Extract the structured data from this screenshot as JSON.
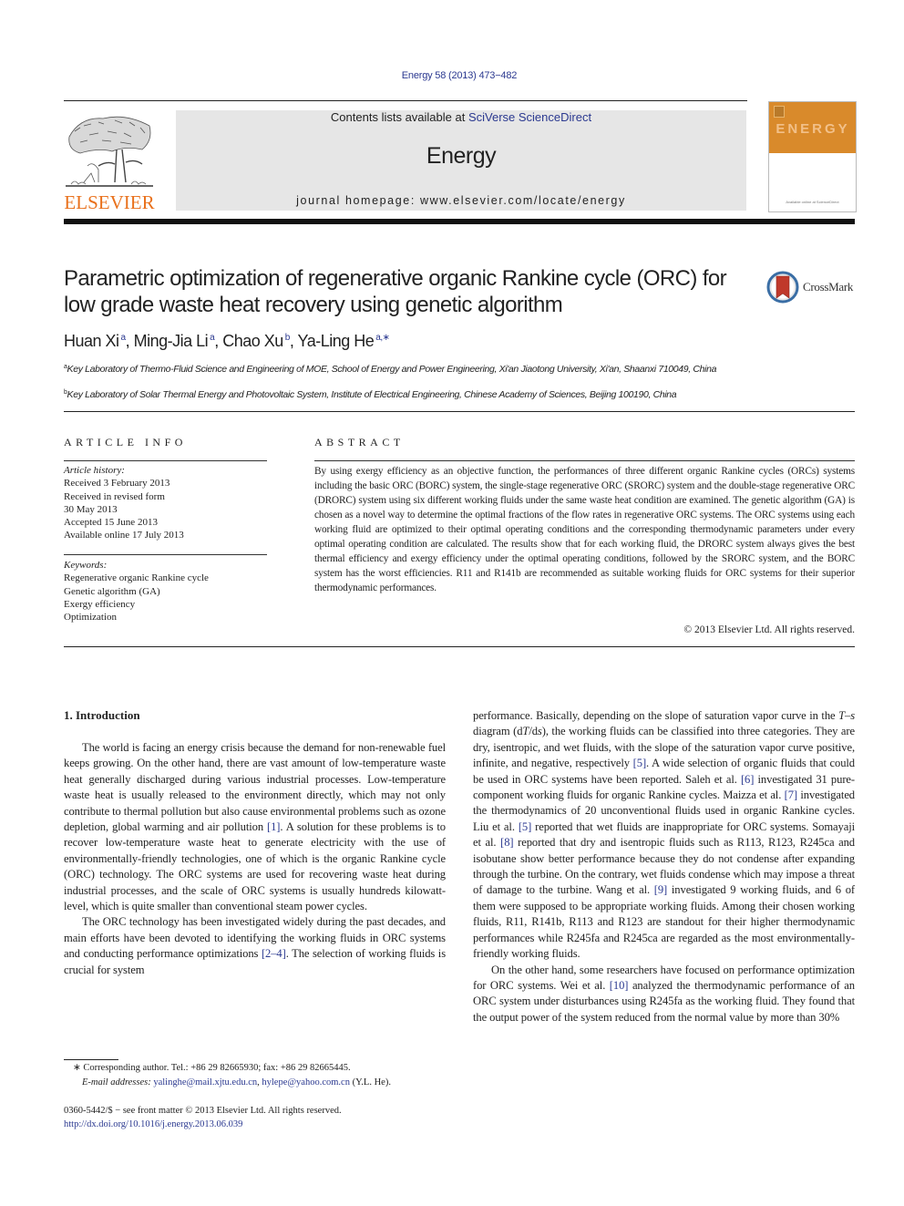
{
  "journal_ref": "Energy 58 (2013) 473−482",
  "masthead": {
    "contents_prefix": "Contents lists available at ",
    "contents_link": "SciVerse ScienceDirect",
    "journal_name": "Energy",
    "homepage": "journal homepage: www.elsevier.com/locate/energy"
  },
  "publisher_logo": "ELSEVIER",
  "cover": {
    "title": "ENERGY",
    "footer": "Available online at ScienceDirect"
  },
  "crossmark": {
    "label": "CrossMark"
  },
  "article": {
    "title": "Parametric optimization of regenerative organic Rankine cycle (ORC) for low grade waste heat recovery using genetic algorithm",
    "authors": [
      {
        "name": "Huan Xi",
        "sup": "a",
        "sep": ", "
      },
      {
        "name": "Ming-Jia Li",
        "sup": "a",
        "sep": ", "
      },
      {
        "name": "Chao Xu",
        "sup": "b",
        "sep": ", "
      },
      {
        "name": "Ya-Ling He",
        "sup": "a,∗",
        "sep": ""
      }
    ],
    "affiliations": [
      {
        "mark": "a",
        "text": "Key Laboratory of Thermo-Fluid Science and Engineering of MOE, School of Energy and Power Engineering, Xi'an Jiaotong University, Xi'an, Shaanxi 710049, China"
      },
      {
        "mark": "b",
        "text": "Key Laboratory of Solar Thermal Energy and Photovoltaic System, Institute of Electrical Engineering, Chinese Academy of Sciences, Beijing 100190, China"
      }
    ]
  },
  "article_info": {
    "heading": "ARTICLE INFO",
    "history_label": "Article history:",
    "history": [
      "Received 3 February 2013",
      "Received in revised form",
      "30 May 2013",
      "Accepted 15 June 2013",
      "Available online 17 July 2013"
    ],
    "keywords_label": "Keywords:",
    "keywords": [
      "Regenerative organic Rankine cycle",
      "Genetic algorithm (GA)",
      "Exergy efficiency",
      "Optimization"
    ]
  },
  "abstract": {
    "heading": "ABSTRACT",
    "text": "By using exergy efficiency as an objective function, the performances of three different organic Rankine cycles (ORCs) systems including the basic ORC (BORC) system, the single-stage regenerative ORC (SRORC) system and the double-stage regenerative ORC (DRORC) system using six different working fluids under the same waste heat condition are examined. The genetic algorithm (GA) is chosen as a novel way to determine the optimal fractions of the flow rates in regenerative ORC systems. The ORC systems using each working fluid are optimized to their optimal operating conditions and the corresponding thermodynamic parameters under every optimal operating condition are calculated. The results show that for each working fluid, the DRORC system always gives the best thermal efficiency and exergy efficiency under the optimal operating conditions, followed by the SRORC system, and the BORC system has the worst efficiencies. R11 and R141b are recommended as suitable working fluids for ORC systems for their superior thermodynamic performances.",
    "copyright": "© 2013 Elsevier Ltd. All rights reserved."
  },
  "body": {
    "section_heading": "1.  Introduction",
    "left_paragraphs": [
      [
        {
          "t": "The world is facing an energy crisis because the demand for non-renewable fuel keeps growing. On the other hand, there are vast amount of low-temperature waste heat generally discharged during various industrial processes. Low-temperature waste heat is usually released to the environment directly, which may not only contribute to thermal pollution but also cause environmental problems such as ozone depletion, global warming and air pollution "
        },
        {
          "ref": "[1]"
        },
        {
          "t": ". A solution for these problems is to recover low-temperature waste heat to generate electricity with the use of environmentally-friendly technologies, one of which is the organic Rankine cycle (ORC) technology. The ORC systems are used for recovering waste heat during industrial processes, and the scale of ORC systems is usually hundreds kilowatt-level, which is quite smaller than conventional steam power cycles."
        }
      ],
      [
        {
          "t": "The ORC technology has been investigated widely during the past decades, and main efforts have been devoted to identifying the working fluids in ORC systems and conducting performance optimizations "
        },
        {
          "ref": "[2–4]"
        },
        {
          "t": ". The selection of working fluids is crucial for system"
        }
      ]
    ],
    "right_paragraphs": [
      [
        {
          "t": "performance. Basically, depending on the slope of saturation vapor curve in the "
        },
        {
          "i": "T"
        },
        {
          "t": "–"
        },
        {
          "i": "s"
        },
        {
          "t": " diagram (d"
        },
        {
          "i": "T"
        },
        {
          "t": "/d"
        },
        {
          "i": "s"
        },
        {
          "t": "), the working fluids can be classified into three categories. They are dry, isentropic, and wet fluids, with the slope of the saturation vapor curve positive, infinite, and negative, respectively "
        },
        {
          "ref": "[5]"
        },
        {
          "t": ". A wide selection of organic fluids that could be used in ORC systems have been reported. Saleh et al. "
        },
        {
          "ref": "[6]"
        },
        {
          "t": " investigated 31 pure-component working fluids for organic Rankine cycles. Maizza et al. "
        },
        {
          "ref": "[7]"
        },
        {
          "t": " investigated the thermodynamics of 20 unconventional fluids used in organic Rankine cycles. Liu et al. "
        },
        {
          "ref": "[5]"
        },
        {
          "t": " reported that wet fluids are inappropriate for ORC systems. Somayaji et al. "
        },
        {
          "ref": "[8]"
        },
        {
          "t": " reported that dry and isentropic fluids such as R113, R123, R245ca and isobutane show better performance because they do not condense after expanding through the turbine. On the contrary, wet fluids condense which may impose a threat of damage to the turbine. Wang et al. "
        },
        {
          "ref": "[9]"
        },
        {
          "t": " investigated 9 working fluids, and 6 of them were supposed to be appropriate working fluids. Among their chosen working fluids, R11, R141b, R113 and R123 are standout for their higher thermodynamic performances while R245fa and R245ca are regarded as the most environmentally-friendly working fluids."
        }
      ],
      [
        {
          "t": "On the other hand, some researchers have focused on performance optimization for ORC systems. Wei et al. "
        },
        {
          "ref": "[10]"
        },
        {
          "t": " analyzed the thermodynamic performance of an ORC system under disturbances using R245fa as the working fluid. They found that the output power of the system reduced from the normal value by more than 30%"
        }
      ]
    ]
  },
  "footnotes": {
    "corresponding": "∗  Corresponding author. Tel.: +86 29 82665930; fax: +86 29 82665445.",
    "email_label": "E-mail addresses: ",
    "emails": [
      "yalinghe@mail.xjtu.edu.cn",
      "hylepe@yahoo.com.cn"
    ],
    "email_suffix": " (Y.L. He).",
    "issn": "0360-5442/$ − see front matter © 2013 Elsevier Ltd. All rights reserved.",
    "doi": "http://dx.doi.org/10.1016/j.energy.2013.06.039"
  },
  "colors": {
    "link": "#2b3990",
    "elsevier_orange": "#e9711c",
    "cover_orange": "#d98a2b",
    "masthead_gray": "#e6e6e6"
  }
}
